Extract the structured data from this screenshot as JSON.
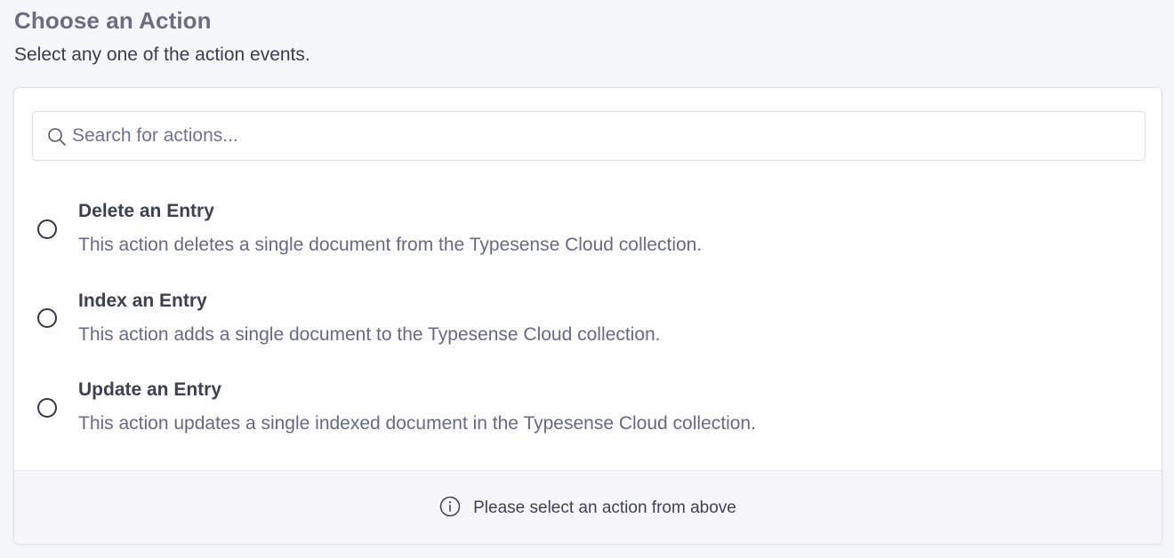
{
  "header": {
    "title": "Choose an Action",
    "subtitle": "Select any one of the action events."
  },
  "search": {
    "placeholder": "Search for actions...",
    "value": "",
    "icon": "search-icon"
  },
  "actions": [
    {
      "title": "Delete an Entry",
      "description": "This action deletes a single document from the Typesense Cloud collection.",
      "selected": false
    },
    {
      "title": "Index an Entry",
      "description": "This action adds a single document to the Typesense Cloud collection.",
      "selected": false
    },
    {
      "title": "Update an Entry",
      "description": "This action updates a single indexed document in the Typesense Cloud collection.",
      "selected": false
    }
  ],
  "footer": {
    "message": "Please select an action from above",
    "icon": "info-icon"
  },
  "colors": {
    "page_background": "#f5f6fa",
    "title": "#6b6d83",
    "description": "#666a85",
    "radio_border": "#34374a",
    "footer_background": "#f6f6fb"
  }
}
